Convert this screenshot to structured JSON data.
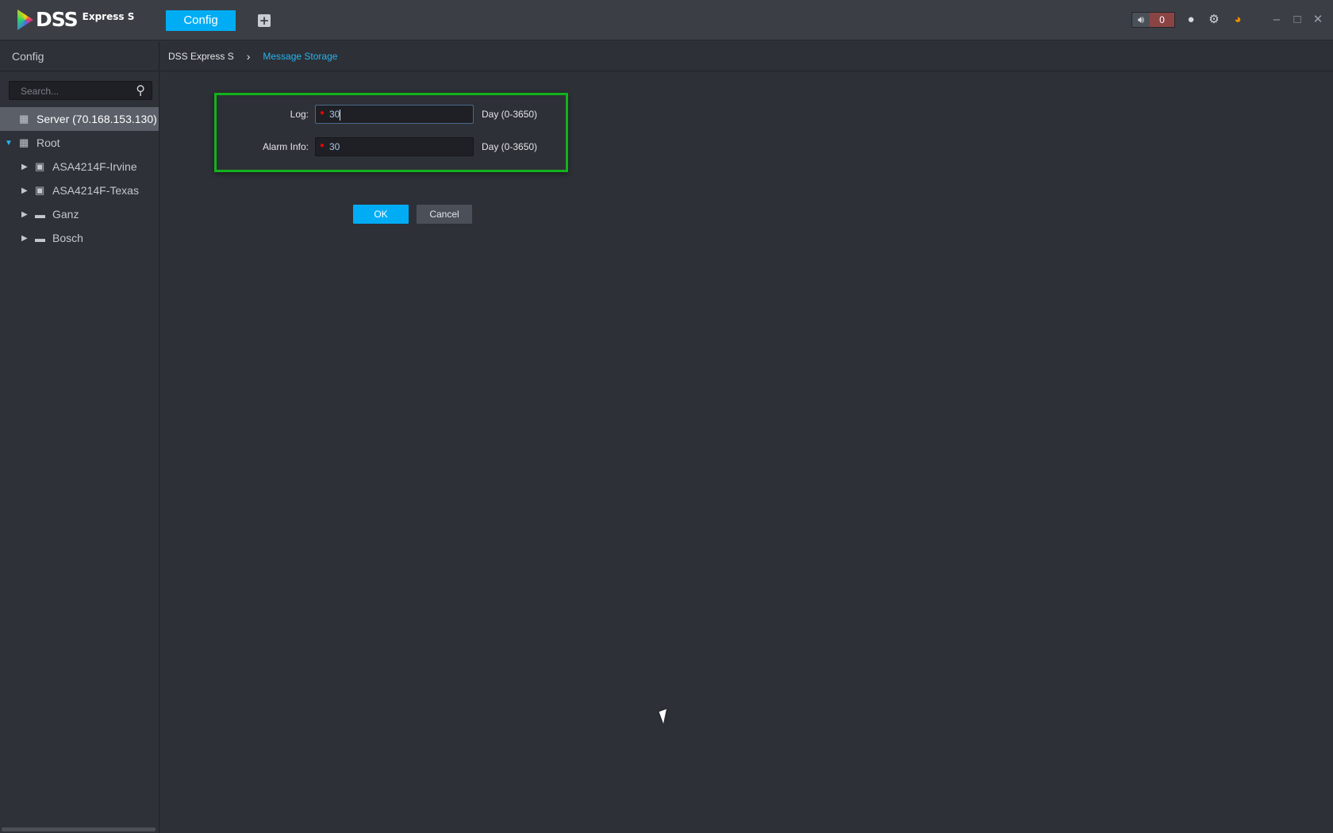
{
  "app": {
    "logo_text": "DSS",
    "logo_sub": "Express S",
    "active_tab": "Config",
    "add_tab_icon": "plus-icon"
  },
  "topbar": {
    "alarm_count": "0",
    "icons": [
      "speaker-icon",
      "user-icon",
      "gear-icon",
      "performance-gauge-icon",
      "minimize-icon",
      "maximize-icon",
      "close-icon"
    ],
    "accent": "#00adf5",
    "gauge_color": "#f08c00"
  },
  "sidebar": {
    "title": "Config",
    "search_placeholder": "Search...",
    "tree": [
      {
        "label": "Server (70.168.153.130)",
        "icon": "server-icon",
        "selected": true
      },
      {
        "label": "Root",
        "icon": "org-icon",
        "expanded": true
      },
      {
        "label": "ASA4214F-Irvine",
        "icon": "device-icon"
      },
      {
        "label": "ASA4214F-Texas",
        "icon": "device-icon"
      },
      {
        "label": "Ganz",
        "icon": "nvr-icon"
      },
      {
        "label": "Bosch",
        "icon": "nvr-icon"
      }
    ]
  },
  "breadcrumb": {
    "root": "DSS Express S",
    "current": "Message Storage"
  },
  "form": {
    "log": {
      "label": "Log:",
      "value": "30",
      "unit": "Day (0-3650)"
    },
    "alarm": {
      "label": "Alarm Info:",
      "value": "30",
      "unit": "Day (0-3650)"
    },
    "ok_label": "OK",
    "cancel_label": "Cancel"
  }
}
